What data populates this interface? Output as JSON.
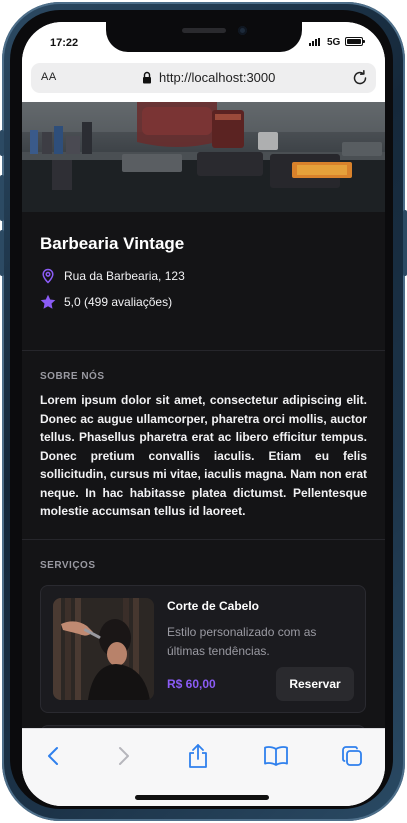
{
  "status_bar": {
    "time": "17:22",
    "network": "5G"
  },
  "browser": {
    "text_size_label": "AA",
    "url": "http://localhost:3000"
  },
  "shop": {
    "name": "Barbearia Vintage",
    "address": "Rua da Barbearia, 123",
    "rating": "5,0 (499 avaliações)"
  },
  "about": {
    "title": "SOBRE NÓS",
    "text": "Lorem ipsum dolor sit amet, consectetur adipiscing elit. Donec ac augue ullamcorper, pharetra orci mollis, auctor tellus. Phasellus pharetra erat ac libero efficitur tempus. Donec pretium convallis iaculis. Etiam eu felis sollicitudin, cursus mi vitae, iaculis magna. Nam non erat neque. In hac habitasse platea dictumst. Pellentesque molestie accumsan tellus id laoreet."
  },
  "services": {
    "title": "SERVIÇOS",
    "items": [
      {
        "name": "Corte de Cabelo",
        "description": "Estilo personalizado com as últimas tendências.",
        "price": "R$ 60,00",
        "button_label": "Reservar"
      }
    ]
  },
  "icons": {
    "location": "map-pin-icon",
    "rating": "star-icon",
    "toolbar": [
      "back-arrow-icon",
      "forward-arrow-icon",
      "share-icon",
      "bookmarks-icon",
      "tabs-icon"
    ]
  },
  "colors": {
    "accent": "#8b5cf6",
    "background": "#141416",
    "card": "#1b1b1f",
    "browser_blue": "#2f80ed"
  }
}
